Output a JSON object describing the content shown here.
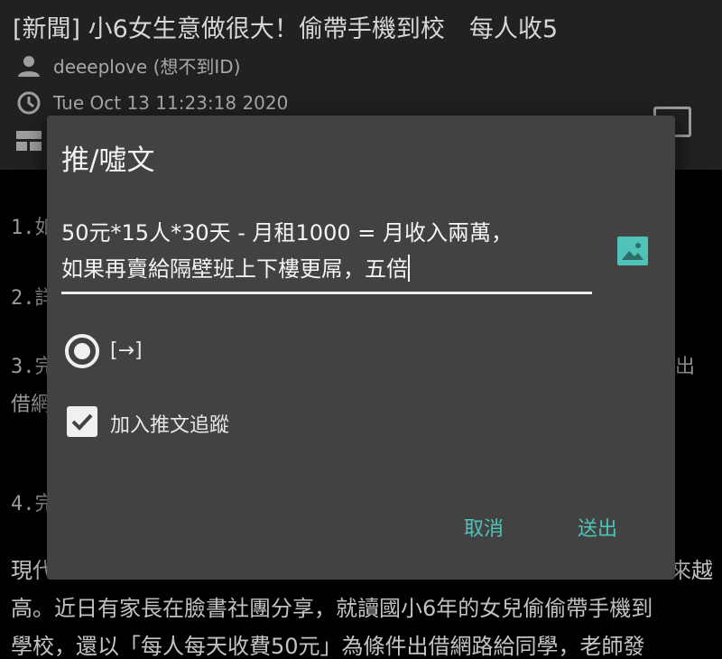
{
  "post": {
    "title": "[新聞] 小6女生意做很大！偷帶手機到校　每人收5",
    "author": "deeeplove (想不到ID)",
    "time": "Tue Oct 13 11:23:18 2020",
    "board_icon": "board-icon",
    "lines": [
      "1.如",
      "2.詳",
      "3.完",
      "借網",
      "4.完"
    ],
    "line_right_1": "出",
    "article_lines": [
      "現代",
      "高。近日有家長在臉書社團分享，就讀國小6年的女兒偷偷帶手機到",
      "學校，還以「每人每天收費50元」為條件出借網路給同學，老師發"
    ],
    "article_right": "來越"
  },
  "dialog": {
    "title": "推/噓文",
    "input_value": "50元*15人*30天 - 月租1000 = 月收入兩萬，\n如果再賣給隔壁班上下樓更屌，五倍",
    "radio_label": "[→]",
    "checkbox_label": "加入推文追蹤",
    "cancel_label": "取消",
    "send_label": "送出"
  },
  "colors": {
    "accent": "#4fc3b8",
    "dialog_bg": "#424242",
    "header_bg": "#212121"
  }
}
